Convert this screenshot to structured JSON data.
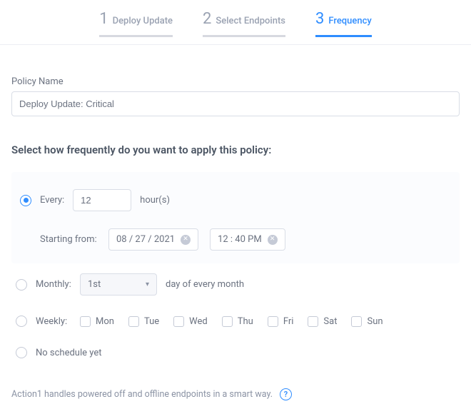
{
  "stepper": {
    "steps": [
      {
        "num": "1",
        "label": "Deploy Update"
      },
      {
        "num": "2",
        "label": "Select Endpoints"
      },
      {
        "num": "3",
        "label": "Frequency"
      }
    ]
  },
  "policyName": {
    "label": "Policy Name",
    "value": "Deploy Update: Critical"
  },
  "sectionHeading": "Select how frequently do you want to apply this policy:",
  "every": {
    "label": "Every:",
    "value": "12",
    "unit": "hour(s)",
    "startingLabel": "Starting from:",
    "date": "08 / 27 / 2021",
    "time": "12 : 40   PM"
  },
  "monthly": {
    "label": "Monthly:",
    "selectValue": "1st",
    "suffix": "day of every month"
  },
  "weekly": {
    "label": "Weekly:",
    "days": [
      "Mon",
      "Tue",
      "Wed",
      "Thu",
      "Fri",
      "Sat",
      "Sun"
    ]
  },
  "noSchedule": {
    "label": "No schedule yet"
  },
  "footnote": {
    "text": "Action1 handles powered off and offline endpoints in a smart way.",
    "helpGlyph": "?"
  },
  "icons": {
    "clear": "✕",
    "chevronDown": "▾"
  }
}
